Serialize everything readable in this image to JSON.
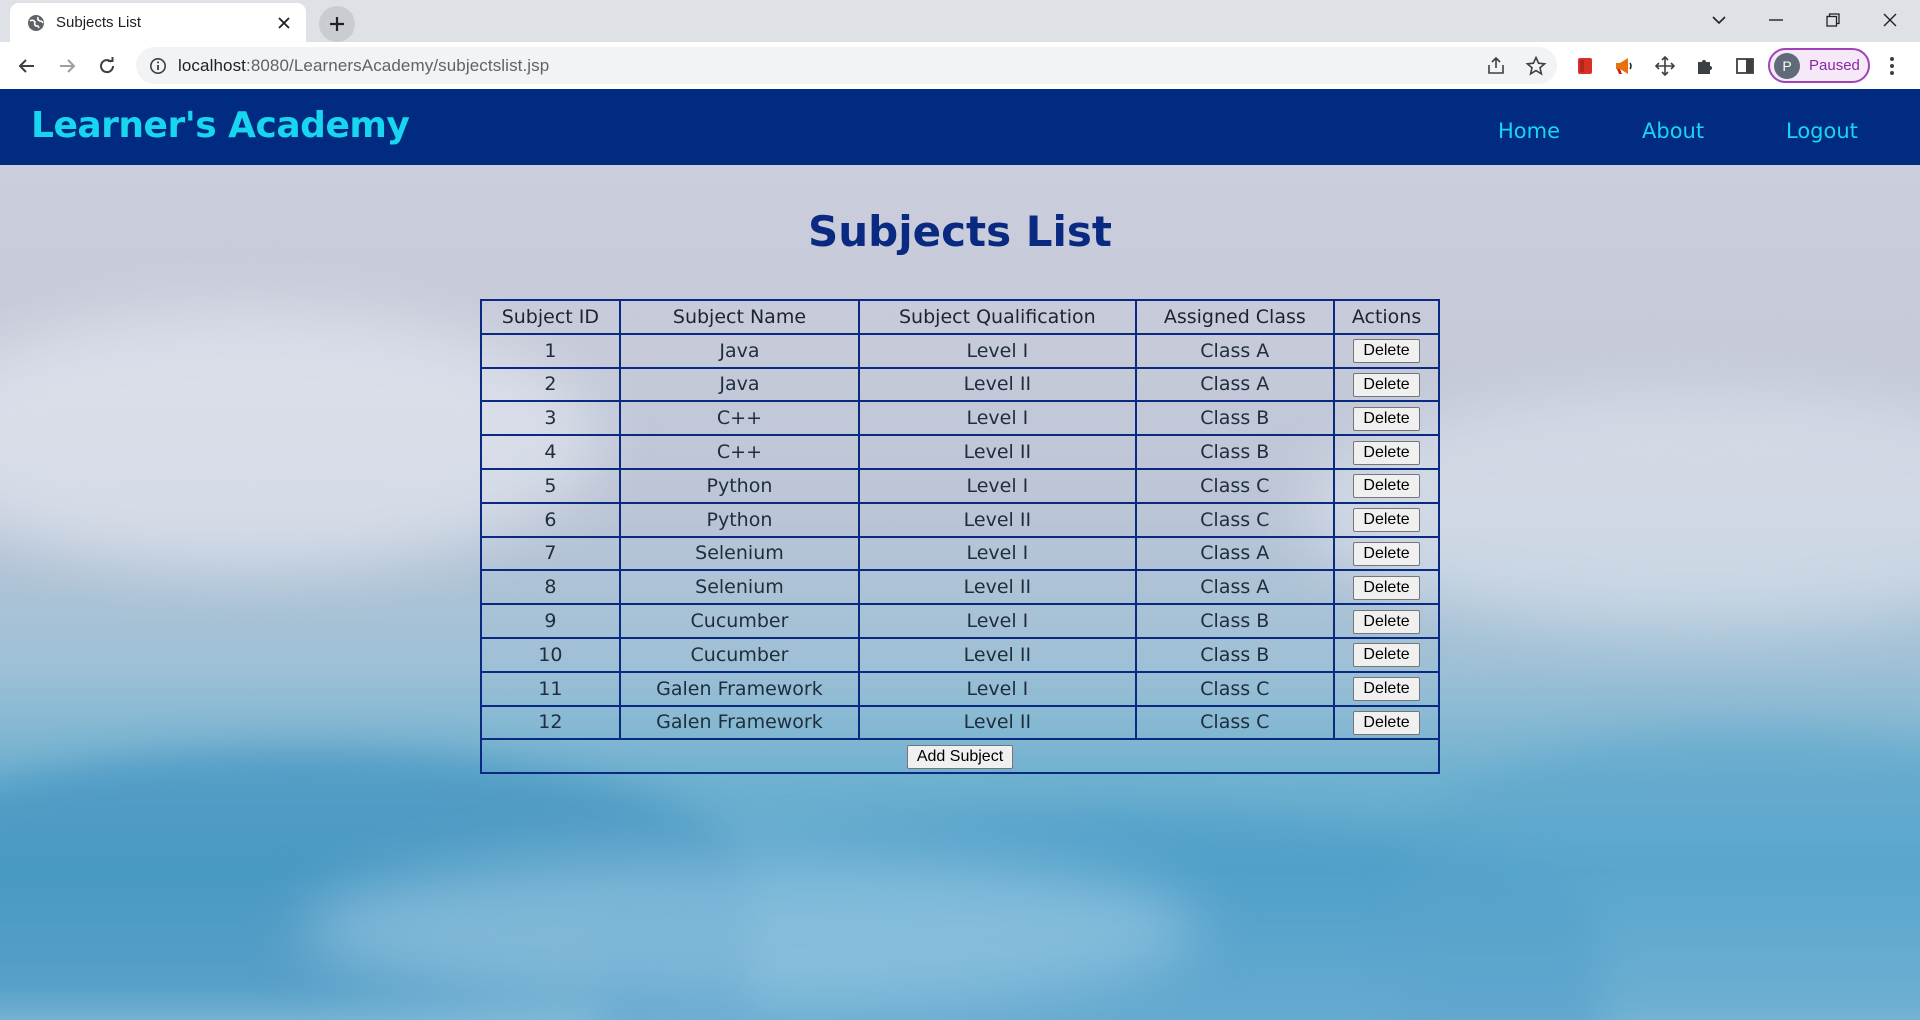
{
  "browser": {
    "tab_title": "Subjects List",
    "url_host": "localhost",
    "url_rest": ":8080/LearnersAcademy/subjectslist.jsp",
    "profile_initial": "P",
    "profile_status": "Paused"
  },
  "site": {
    "brand": "Learner's Academy",
    "nav": {
      "home": "Home",
      "about": "About",
      "logout": "Logout"
    }
  },
  "page": {
    "title": "Subjects List"
  },
  "table": {
    "headers": [
      "Subject ID",
      "Subject Name",
      "Subject Qualification",
      "Assigned Class",
      "Actions"
    ],
    "rows": [
      {
        "id": "1",
        "name": "Java",
        "qualification": "Level I",
        "class": "Class A",
        "action": "Delete"
      },
      {
        "id": "2",
        "name": "Java",
        "qualification": "Level II",
        "class": "Class A",
        "action": "Delete"
      },
      {
        "id": "3",
        "name": "C++",
        "qualification": "Level I",
        "class": "Class B",
        "action": "Delete"
      },
      {
        "id": "4",
        "name": "C++",
        "qualification": "Level II",
        "class": "Class B",
        "action": "Delete"
      },
      {
        "id": "5",
        "name": "Python",
        "qualification": "Level I",
        "class": "Class C",
        "action": "Delete"
      },
      {
        "id": "6",
        "name": "Python",
        "qualification": "Level II",
        "class": "Class C",
        "action": "Delete"
      },
      {
        "id": "7",
        "name": "Selenium",
        "qualification": "Level I",
        "class": "Class A",
        "action": "Delete"
      },
      {
        "id": "8",
        "name": "Selenium",
        "qualification": "Level II",
        "class": "Class A",
        "action": "Delete"
      },
      {
        "id": "9",
        "name": "Cucumber",
        "qualification": "Level I",
        "class": "Class B",
        "action": "Delete"
      },
      {
        "id": "10",
        "name": "Cucumber",
        "qualification": "Level II",
        "class": "Class B",
        "action": "Delete"
      },
      {
        "id": "11",
        "name": "Galen Framework",
        "qualification": "Level I",
        "class": "Class C",
        "action": "Delete"
      },
      {
        "id": "12",
        "name": "Galen Framework",
        "qualification": "Level II",
        "class": "Class C",
        "action": "Delete"
      }
    ],
    "add_button": "Add Subject"
  },
  "colors": {
    "header_bg": "#002b80",
    "brand_cyan": "#19d6f0",
    "title_navy": "#0a2a82",
    "profile_accent": "#a142b8"
  },
  "icons": [
    "globe-icon",
    "close-icon",
    "plus-icon",
    "chevron-down-icon",
    "minimize-icon",
    "restore-icon",
    "back-arrow-icon",
    "forward-arrow-icon",
    "reload-icon",
    "info-icon",
    "share-icon",
    "star-icon",
    "extension-red-icon",
    "megaphone-icon",
    "move-icon",
    "puzzle-icon",
    "sidebar-icon",
    "kebab-menu-icon"
  ]
}
